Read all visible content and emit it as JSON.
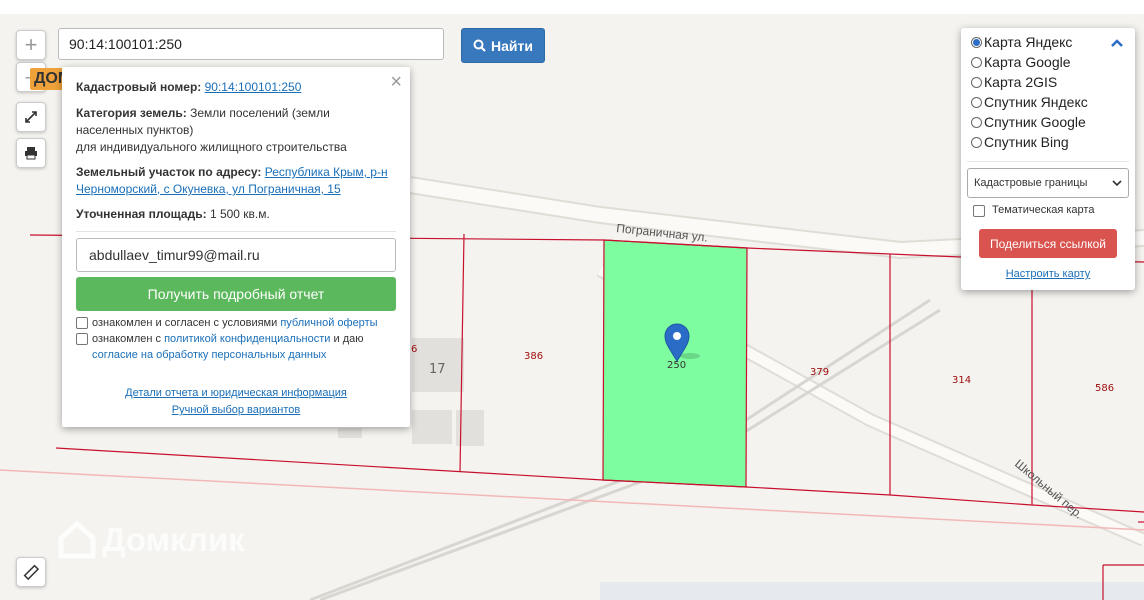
{
  "search": {
    "value": "90:14:100101:250",
    "button_label": "Найти"
  },
  "map_controls": {
    "zoom_in": "+",
    "zoom_out": "–"
  },
  "brand_badge": "ДОМ ХИТ",
  "watermark": "Домклик",
  "popup": {
    "cadastral_label": "Кадастровый номер:",
    "cadastral_value": "90:14:100101:250",
    "category_label": "Категория земель:",
    "category_value_line1": "Земли поселений (земли",
    "category_value_line2": "населенных пунктов)",
    "category_value_line3": "для индивидуального жилищного строительства",
    "address_label": "Земельный участок по адресу:",
    "address_line1": "Республика Крым, р-н",
    "address_line2": "Черноморский, с Окуневка, ул Пограничная, 15",
    "area_label": "Уточненная площадь:",
    "area_value": "1 500 кв.м.",
    "email_value": "abdullaev_timur99@mail.ru",
    "report_button": "Получить подробный отчет",
    "consent1_text": "ознакомлен и согласен с условиями",
    "consent1_link": "публичной оферты",
    "consent2_text": "ознакомлен с",
    "consent2_link": "политикой конфиденциальности",
    "consent2_tail": "и даю",
    "consent2_line2": "согласие на обработку персональных данных",
    "details_link": "Детали отчета и юридическая информация",
    "manual_link": "Ручной выбор вариантов"
  },
  "layers": {
    "options": [
      "Карта Яндекс",
      "Карта Google",
      "Карта 2GIS",
      "Спутник Яндекс",
      "Спутник Google",
      "Спутник Bing"
    ],
    "selected": "Карта Яндекс",
    "select_value": "Кадастровые границы",
    "thematic_label": "Тематическая карта",
    "share_button": "Поделиться ссылкой",
    "configure_link": "Настроить карту"
  },
  "map_labels": {
    "street1": "Пограничная ул.",
    "street2": "Школьный пер.",
    "parcels": [
      "386",
      "379",
      "314",
      "586",
      "6",
      "17"
    ],
    "marker_label": "250"
  },
  "colors": {
    "accent": "#3879bd",
    "parcel_fill": "#7dfca0",
    "report_btn": "#5cb85c",
    "share_btn": "#d9534f",
    "badge": "#f0a23a"
  }
}
